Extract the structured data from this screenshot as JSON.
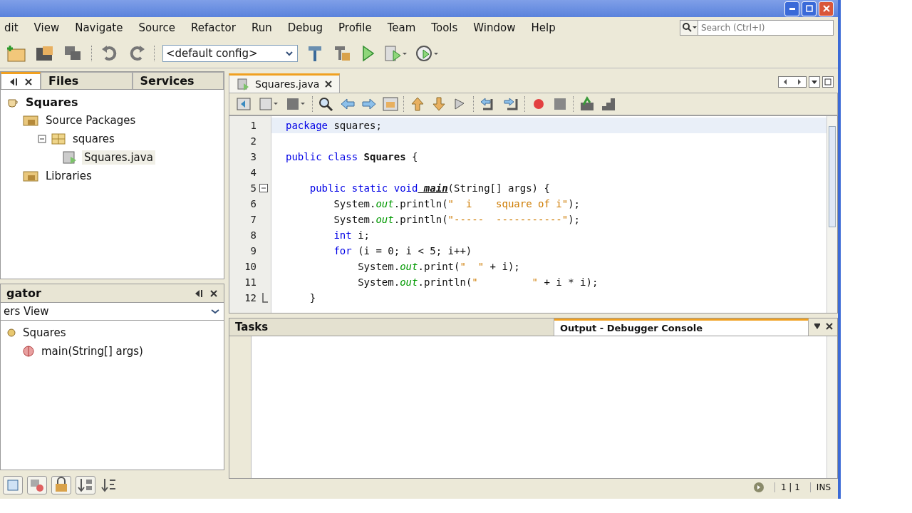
{
  "menu": [
    "dit",
    "View",
    "Navigate",
    "Source",
    "Refactor",
    "Run",
    "Debug",
    "Profile",
    "Team",
    "Tools",
    "Window",
    "Help"
  ],
  "toolbar": {
    "config": "<default config>"
  },
  "search": {
    "placeholder": "Search (Ctrl+I)"
  },
  "projects": {
    "tabs": [
      {
        "selected": true
      },
      {
        "label": "Files",
        "selected": false
      },
      {
        "label": "Services",
        "selected": false
      }
    ],
    "tree": [
      {
        "label": "Squares",
        "kind": "project",
        "children": [
          {
            "label": "Source Packages",
            "kind": "folder",
            "children": [
              {
                "label": "squares",
                "kind": "package",
                "expanded": true,
                "children": [
                  {
                    "label": "Squares.java",
                    "kind": "file",
                    "selected": true
                  }
                ]
              }
            ]
          },
          {
            "label": "Libraries",
            "kind": "folder"
          }
        ]
      }
    ]
  },
  "navigator": {
    "title": "gator",
    "view": "ers View",
    "tree": [
      {
        "label": "Squares",
        "kind": "class",
        "children": [
          {
            "label": "main(String[] args)",
            "kind": "method"
          }
        ]
      }
    ]
  },
  "editor": {
    "tabs": [
      {
        "label": "Squares.java",
        "selected": true
      }
    ],
    "lines": [
      {
        "number": "1",
        "kind": "code",
        "segs": [
          {
            "text": "package",
            "kind": "keyword"
          },
          {
            "text": " squares;",
            "kind": "plain"
          }
        ]
      },
      {
        "number": "2",
        "kind": "blank"
      },
      {
        "number": "3",
        "kind": "code",
        "segs": [
          {
            "text": "public class",
            "kind": "keyword"
          },
          {
            "text": " Squares",
            "kind": "classname"
          },
          {
            "text": " {",
            "kind": "plain"
          }
        ]
      },
      {
        "number": "4",
        "kind": "blank"
      },
      {
        "number": "5",
        "kind": "fold-start",
        "segs": [
          {
            "text": "    public static void",
            "kind": "keyword"
          },
          {
            "text": " main",
            "kind": "method"
          },
          {
            "text": "(String[] args) {",
            "kind": "plain"
          }
        ]
      },
      {
        "number": "6",
        "kind": "code",
        "segs": [
          {
            "text": "        System.",
            "kind": "plain"
          },
          {
            "text": "out",
            "kind": "field"
          },
          {
            "text": ".println(",
            "kind": "plain"
          },
          {
            "text": "\"  i    square of i\"",
            "kind": "string"
          },
          {
            "text": ");",
            "kind": "plain"
          }
        ]
      },
      {
        "number": "7",
        "kind": "code",
        "segs": [
          {
            "text": "        System.",
            "kind": "plain"
          },
          {
            "text": "out",
            "kind": "field"
          },
          {
            "text": ".println(",
            "kind": "plain"
          },
          {
            "text": "\"-----  -----------\"",
            "kind": "string"
          },
          {
            "text": ");",
            "kind": "plain"
          }
        ]
      },
      {
        "number": "8",
        "kind": "code",
        "segs": [
          {
            "text": "        int",
            "kind": "keyword"
          },
          {
            "text": " i;",
            "kind": "plain"
          }
        ]
      },
      {
        "number": "9",
        "kind": "code",
        "segs": [
          {
            "text": "        for",
            "kind": "keyword"
          },
          {
            "text": " (i = 0; i < 5; i++)",
            "kind": "plain"
          }
        ]
      },
      {
        "number": "10",
        "kind": "code",
        "segs": [
          {
            "text": "            System.",
            "kind": "plain"
          },
          {
            "text": "out",
            "kind": "field"
          },
          {
            "text": ".print(",
            "kind": "plain"
          },
          {
            "text": "\"  \"",
            "kind": "string"
          },
          {
            "text": " + i);",
            "kind": "plain"
          }
        ]
      },
      {
        "number": "11",
        "kind": "code",
        "segs": [
          {
            "text": "            System.",
            "kind": "plain"
          },
          {
            "text": "out",
            "kind": "field"
          },
          {
            "text": ".println(",
            "kind": "plain"
          },
          {
            "text": "\"         \"",
            "kind": "string"
          },
          {
            "text": " + i * i);",
            "kind": "plain"
          }
        ]
      },
      {
        "number": "12",
        "kind": "fold-end",
        "segs": [
          {
            "text": "    }",
            "kind": "plain"
          }
        ]
      }
    ]
  },
  "bottom": {
    "tabs": [
      {
        "label": "Tasks",
        "selected": false
      },
      {
        "label": "Output - Debugger Console",
        "selected": true
      }
    ]
  },
  "status": {
    "position": "1 | 1",
    "mode": "INS"
  }
}
